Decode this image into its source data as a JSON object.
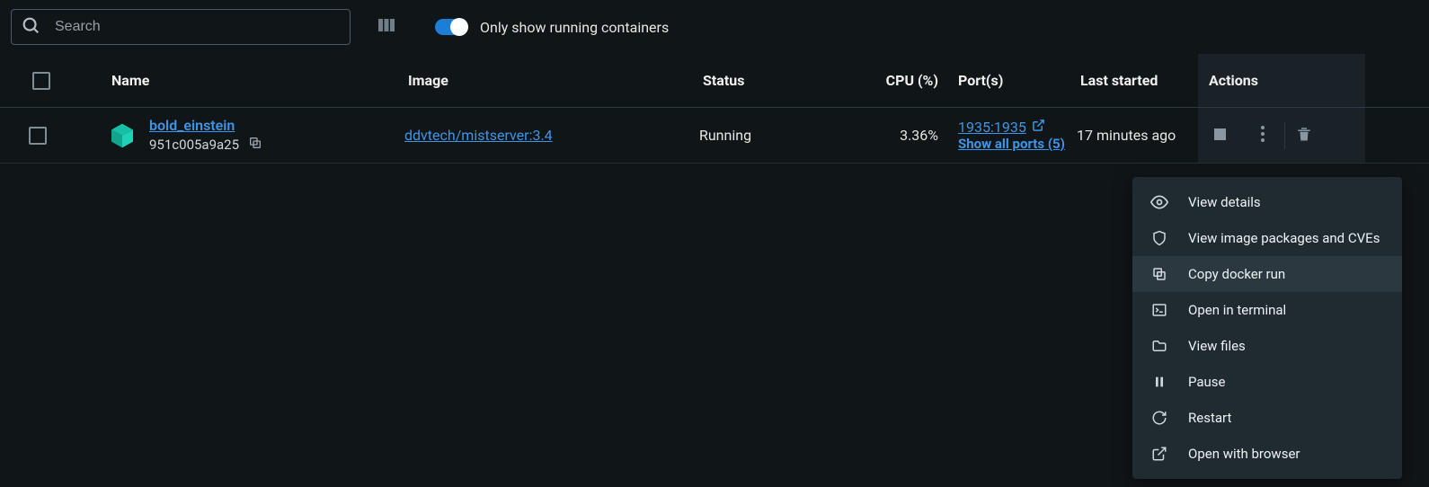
{
  "toolbar": {
    "search_placeholder": "Search",
    "toggle_label": "Only show running containers",
    "toggle_on": true
  },
  "columns": {
    "name": "Name",
    "image": "Image",
    "status": "Status",
    "cpu": "CPU (%)",
    "ports": "Port(s)",
    "last_started": "Last started",
    "actions": "Actions"
  },
  "rows": [
    {
      "name": "bold_einstein",
      "id": "951c005a9a25",
      "image": "ddvtech/mistserver:3.4",
      "status": "Running",
      "cpu": "3.36%",
      "port_primary": "1935:1935",
      "show_all_ports": "Show all ports (5)",
      "last_started": "17 minutes ago"
    }
  ],
  "menu": {
    "items": [
      {
        "icon": "eye",
        "label": "View details"
      },
      {
        "icon": "shield",
        "label": "View image packages and CVEs"
      },
      {
        "icon": "copy",
        "label": "Copy docker run",
        "hover": true
      },
      {
        "icon": "terminal",
        "label": "Open in terminal"
      },
      {
        "icon": "folder",
        "label": "View files"
      },
      {
        "icon": "pause",
        "label": "Pause"
      },
      {
        "icon": "restart",
        "label": "Restart"
      },
      {
        "icon": "open",
        "label": "Open with browser"
      }
    ]
  }
}
